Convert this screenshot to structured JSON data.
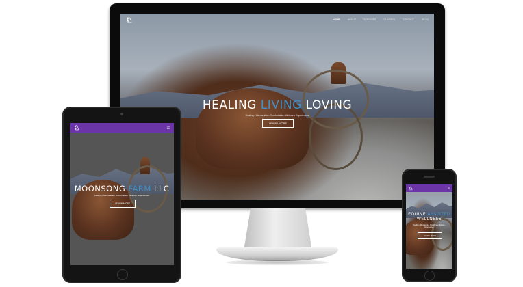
{
  "desktop": {
    "logo": "♘",
    "nav": [
      "HOME",
      "ABOUT",
      "SERVICES",
      "CLASSES",
      "CONTACT",
      "BLOG"
    ],
    "hero": {
      "word1": "HEALING ",
      "word2": "LIVING",
      "word3": " LOVING"
    },
    "tagline": "Healing  •  Memorable  •  Comfortable  •  Lifetime  •  Experiences",
    "cta": "LEARN MORE"
  },
  "tablet": {
    "logo": "♘",
    "menu": "≡",
    "hero": {
      "word1": "MOONSONG ",
      "word2": "FARM",
      "word3": " LLC"
    },
    "tagline": "Healing  •  Memorable  •  Comfortable  •  Lifetime  •  Experiences",
    "cta": "LEARN MORE"
  },
  "phone": {
    "logo": "♘",
    "menu": "≡",
    "hero": {
      "line1": "EQUINE ",
      "accent": "ASSISTED",
      "line2": "WELLNESS"
    },
    "tagline": "Healing  •  Memorable  •  Confidence  Lifetime  •  Experiences",
    "cta": "LEARN MORE"
  },
  "colors": {
    "accent_blue": "#3f8fc9",
    "mobile_header_purple": "#6b35a8"
  }
}
